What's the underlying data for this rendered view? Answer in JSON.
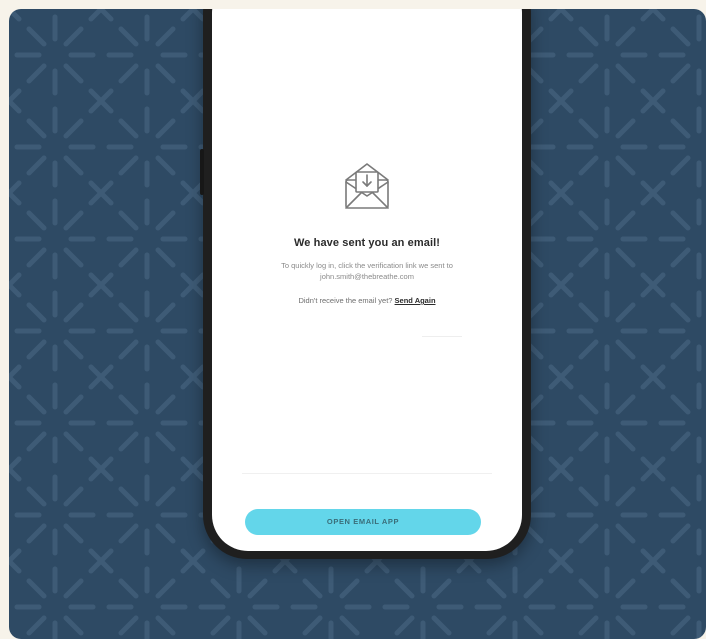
{
  "colors": {
    "page_background": "#f7f3ea",
    "card_background": "#2e4a64",
    "pattern_stroke": "#3e5b76",
    "phone_frame": "#1f1f1f",
    "screen_background": "#ffffff",
    "button_background": "#63d6ea"
  },
  "icons": {
    "envelope": "envelope-download-icon"
  },
  "email_screen": {
    "title": "We have sent you an email!",
    "body": "To quickly log in, click the verification link we sent to john.smith@thebreathe.com",
    "resend_prompt": "Didn't receive the email yet?",
    "resend_link": "Send Again",
    "open_app_button": "OPEN EMAIL APP"
  }
}
